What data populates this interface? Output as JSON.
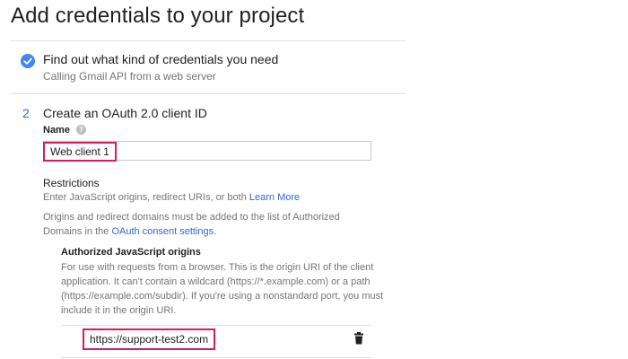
{
  "page": {
    "title": "Add credentials to your project"
  },
  "step1": {
    "title": "Find out what kind of credentials you need",
    "subtitle": "Calling Gmail API from a web server",
    "icon": "check-circle-icon",
    "accent": "#4285f4"
  },
  "step2": {
    "number": "2",
    "title": "Create an OAuth 2.0 client ID",
    "name_label": "Name",
    "help_icon": "help-icon",
    "name_value": "Web client 1"
  },
  "restrictions": {
    "title": "Restrictions",
    "desc_prefix": "Enter JavaScript origins, redirect URIs, or both ",
    "learn_more": "Learn More",
    "note_prefix": "Origins and redirect domains must be added to the list of Authorized Domains in the ",
    "note_link": "OAuth consent settings",
    "note_suffix": "."
  },
  "origins": {
    "title": "Authorized JavaScript origins",
    "description": "For use with requests from a browser. This is the origin URI of the client application. It can't contain a wildcard (https://*.example.com) or a path (https://example.com/subdir). If you're using a nonstandard port, you must include it in the origin URI.",
    "items": [
      {
        "value": "https://support-test2.com",
        "delete_icon": "trash-icon"
      }
    ]
  },
  "colors": {
    "highlight": "#d81b60",
    "link": "#3367d6",
    "muted_text": "#757575"
  }
}
